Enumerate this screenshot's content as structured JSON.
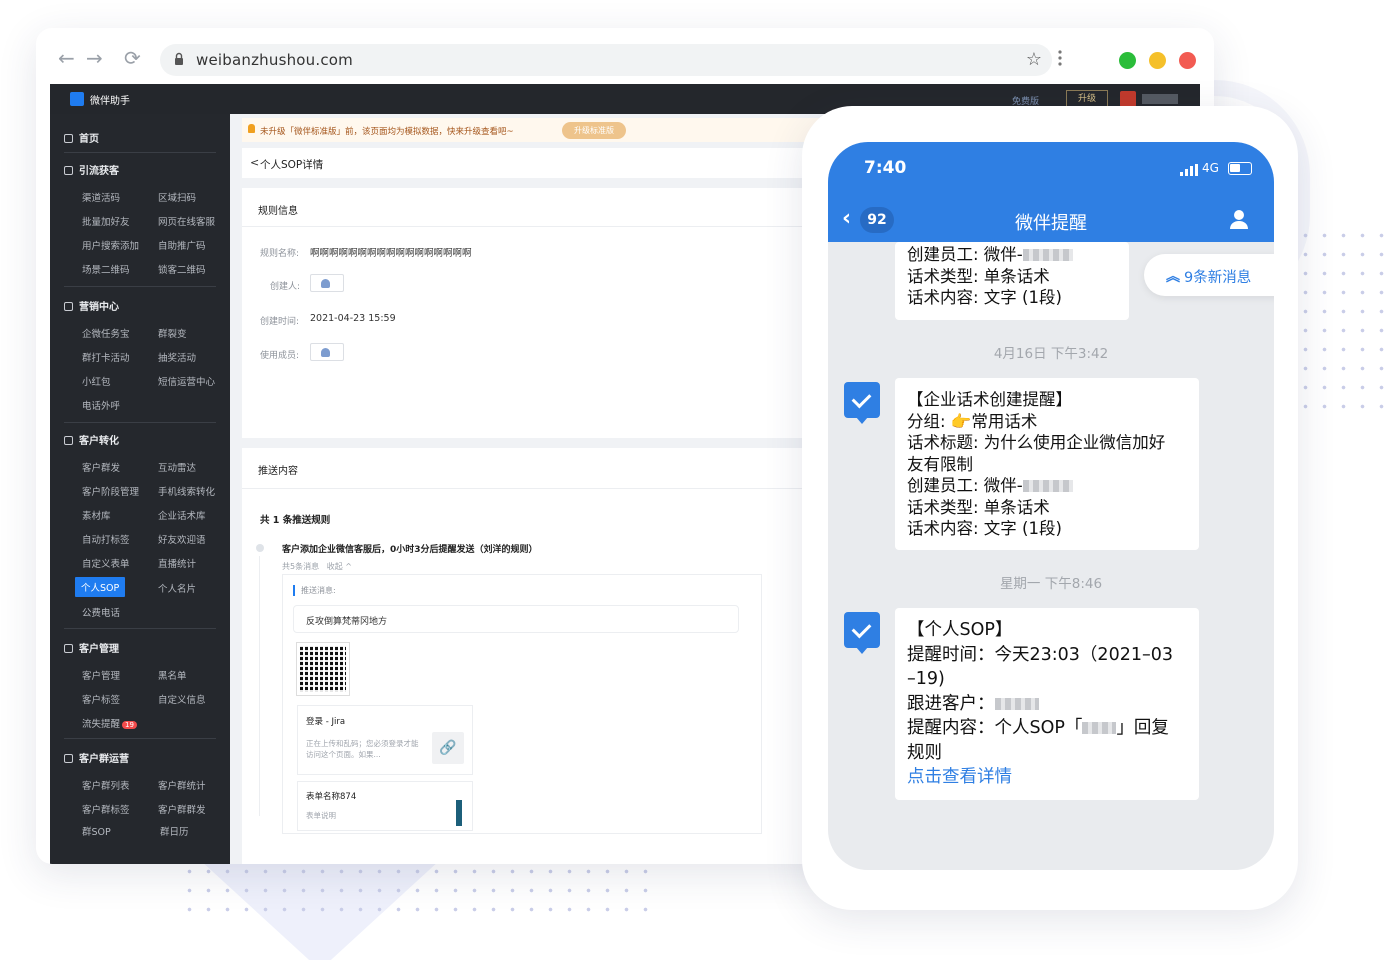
{
  "browser": {
    "url": "weibanzhushou.com",
    "traffic_colors": [
      "#2bbd3a",
      "#f5c02a",
      "#f25b52"
    ]
  },
  "app": {
    "brand": "微伴助手",
    "topbar": {
      "free_label": "免费版",
      "upgrade_label": "升级"
    },
    "sidebar": {
      "home": "首页",
      "sections": [
        {
          "title": "引流获客",
          "items": [
            "渠道活码",
            "区域扫码",
            "批量加好友",
            "网页在线客服",
            "用户搜索添加",
            "自助推广码",
            "场景二维码",
            "锁客二维码"
          ]
        },
        {
          "title": "营销中心",
          "items": [
            "企微任务宝",
            "群裂变",
            "群打卡活动",
            "抽奖活动",
            "小红包",
            "短信运营中心",
            "电话外呼"
          ]
        },
        {
          "title": "客户转化",
          "items": [
            "客户群发",
            "互动雷达",
            "客户阶段管理",
            "手机线索转化",
            "素材库",
            "企业话术库",
            "自动打标签",
            "好友欢迎语",
            "自定义表单",
            "直播统计",
            "个人SOP",
            "个人名片",
            "公费电话"
          ]
        },
        {
          "title": "客户管理",
          "items": [
            "客户管理",
            "黑名单",
            "客户标签",
            "自定义信息",
            "流失提醒"
          ],
          "badge": "19"
        },
        {
          "title": "客户群运营",
          "items": [
            "客户群列表",
            "客户群统计",
            "客户群标签",
            "客户群群发",
            "群SOP",
            "群日历"
          ]
        }
      ],
      "active_item": "个人SOP"
    },
    "notice": {
      "text": "未升级「微伴标准版」前，该页面均为模拟数据，快来升级查看吧~",
      "button": "升级标准版"
    },
    "page_title": "个人SOP详情",
    "rule_info": {
      "title": "规则信息",
      "name_label": "规则名称:",
      "name_value": "啊啊啊啊啊啊啊啊啊啊啊啊啊啊啊啊啊",
      "creator_label": "创建人:",
      "created_label": "创建时间:",
      "created_value": "2021-04-23 15:59",
      "members_label": "使用成员:"
    },
    "push": {
      "title": "推送内容",
      "count_text": "共 1 条推送规则",
      "rule_text": "客户添加企业微信客服后，0小时3分后提醒发送（刘洋的规则）",
      "meta_count": "共5条消息",
      "meta_collapse": "收起 ^",
      "push_label": "推送消息:",
      "message": "反攻倒算梵蒂冈地方",
      "link_title": "登录 - Jira",
      "link_desc": "正在上传和乱码；您必须登录才能访问这个页面。如果...",
      "form_title": "表单名称874",
      "form_desc": "表单说明"
    }
  },
  "phone": {
    "time": "7:40",
    "network": "4G",
    "battery_percent": 50,
    "unread_count": "92",
    "chat_title": "微伴提醒",
    "new_messages": "9条新消息",
    "messages": [
      {
        "lines": [
          "创建员工: 微伴-",
          "话术类型: 单条话术",
          "话术内容: 文字 (1段)"
        ]
      },
      {
        "timestamp": "4月16日 下午3:42",
        "lines": [
          "【企业话术创建提醒】",
          "分组: 👉常用话术",
          "话术标题: 为什么使用企业微信加好",
          "友有限制",
          "创建员工: 微伴-",
          "话术类型: 单条话术",
          "话术内容: 文字 (1段)"
        ]
      },
      {
        "timestamp": "星期一 下午8:46",
        "lines": [
          "【个人SOP】",
          "提醒时间：今天23:03（2021–03",
          "–19)",
          "跟进客户：",
          "提醒内容：个人SOP「",
          "」回复",
          "规则"
        ],
        "link": "点击查看详情"
      }
    ]
  }
}
